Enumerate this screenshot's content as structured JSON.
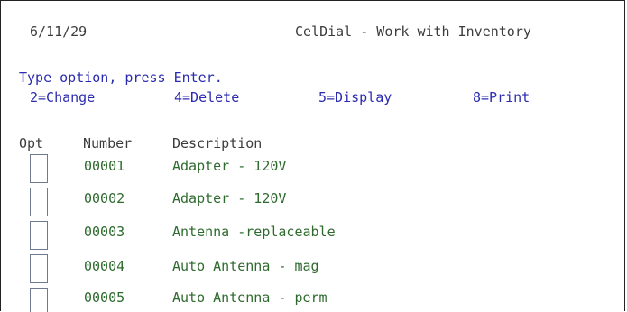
{
  "header": {
    "date": "6/11/29",
    "title": "CelDial - Work with Inventory"
  },
  "instructions": {
    "prompt": "Type option, press Enter.",
    "options": [
      "2=Change",
      "4=Delete",
      "5=Display",
      "8=Print"
    ]
  },
  "columns": {
    "opt": "Opt",
    "number": "Number",
    "description": "Description"
  },
  "rows": [
    {
      "number": "00001",
      "description": "Adapter - 120V",
      "opt": ""
    },
    {
      "number": "00002",
      "description": "Adapter - 120V",
      "opt": ""
    },
    {
      "number": "00003",
      "description": "Antenna -replaceable",
      "opt": ""
    },
    {
      "number": "00004",
      "description": "Auto Antenna - mag",
      "opt": ""
    },
    {
      "number": "00005",
      "description": "Auto Antenna - perm",
      "opt": ""
    }
  ]
}
